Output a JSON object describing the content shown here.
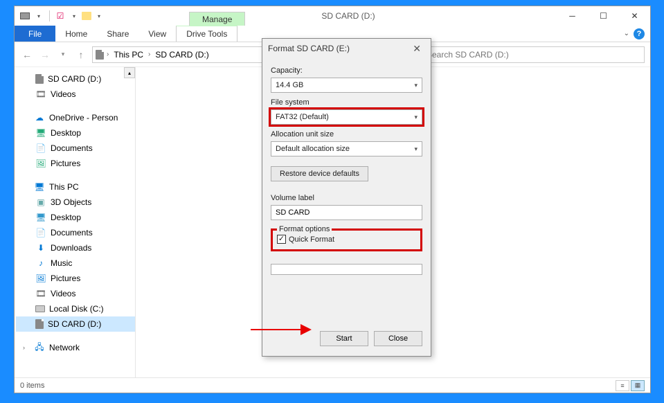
{
  "window": {
    "title": "SD CARD (D:)",
    "manage_tab": "Manage"
  },
  "ribbon": {
    "file": "File",
    "home": "Home",
    "share": "Share",
    "view": "View",
    "drive_tools": "Drive Tools"
  },
  "nav": {
    "back": "←",
    "fwd": "→",
    "up": "↑"
  },
  "breadcrumb": {
    "root": "This PC",
    "leaf": "SD CARD (D:)"
  },
  "search": {
    "placeholder": "Search SD CARD (D:)"
  },
  "tree": {
    "sdcard_d": "SD CARD (D:)",
    "videos": "Videos",
    "onedrive": "OneDrive - Person",
    "desktop": "Desktop",
    "documents": "Documents",
    "pictures": "Pictures",
    "thispc": "This PC",
    "objects": "3D Objects",
    "downloads": "Downloads",
    "music": "Music",
    "localdisk": "Local Disk (C:)",
    "network": "Network"
  },
  "status": {
    "items": "0 items"
  },
  "dialog": {
    "title": "Format SD CARD (E:)",
    "capacity_label": "Capacity:",
    "capacity_value": "14.4 GB",
    "filesystem_label": "File system",
    "filesystem_value": "FAT32 (Default)",
    "alloc_label": "Allocation unit size",
    "alloc_value": "Default allocation size",
    "restore_btn": "Restore device defaults",
    "volume_label_label": "Volume label",
    "volume_label_value": "SD CARD",
    "format_options_label": "Format options",
    "quick_format_label": "Quick Format",
    "quick_format_checked": true,
    "start_btn": "Start",
    "close_btn": "Close"
  }
}
